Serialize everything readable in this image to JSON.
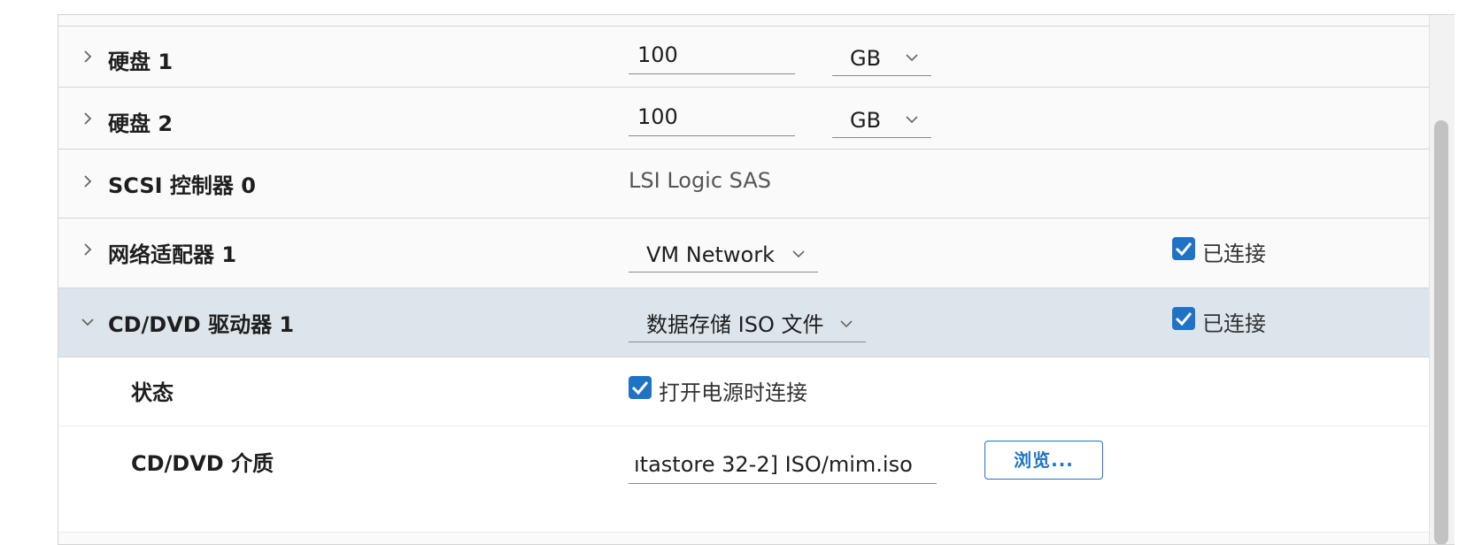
{
  "rows": {
    "disk1": {
      "label": "硬盘 1",
      "value": "100",
      "unit": "GB"
    },
    "disk2": {
      "label": "硬盘 2",
      "value": "100",
      "unit": "GB"
    },
    "scsi": {
      "label": "SCSI 控制器 0",
      "value": "LSI Logic SAS"
    },
    "nic": {
      "label": "网络适配器 1",
      "network": "VM Network",
      "connected_label": "已连接"
    },
    "cddvd": {
      "label": "CD/DVD 驱动器 1",
      "source": "数据存储 ISO 文件",
      "connected_label": "已连接"
    },
    "status": {
      "label": "状态",
      "poweron_label": "打开电源时连接"
    },
    "media": {
      "label": "CD/DVD 介质",
      "path": "ıtastore 32-2] ISO/mim.iso",
      "browse_label": "浏览..."
    }
  },
  "colors": {
    "accent": "#1e73c7",
    "selected_row": "#dde5ec",
    "border": "#d4d4d4"
  },
  "icons": {
    "collapsed": "chevron-right-icon",
    "expanded": "chevron-down-icon",
    "dropdown": "caret-down-icon",
    "checked": "check-icon"
  }
}
